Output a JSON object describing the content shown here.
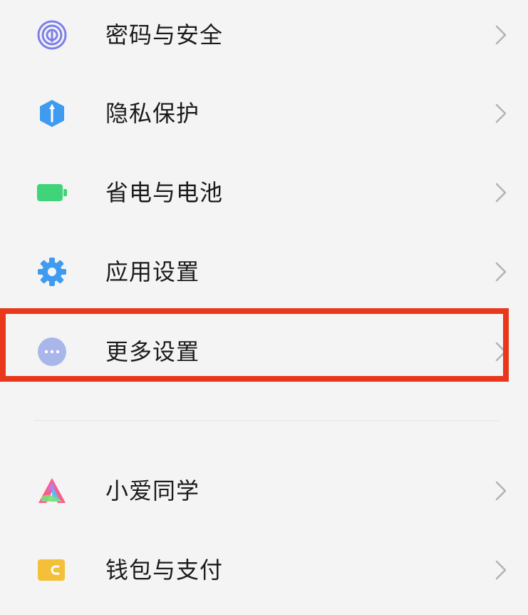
{
  "settings": {
    "items": [
      {
        "label": "密码与安全",
        "icon": "fingerprint-icon",
        "color": "#7c7fe8"
      },
      {
        "label": "隐私保护",
        "icon": "privacy-shield-icon",
        "color": "#3f9bf0"
      },
      {
        "label": "省电与电池",
        "icon": "battery-icon",
        "color": "#3fd37a"
      },
      {
        "label": "应用设置",
        "icon": "gear-icon",
        "color": "#3f9bf0"
      },
      {
        "label": "更多设置",
        "icon": "more-dots-icon",
        "color": "#a9b6ea"
      },
      {
        "label": "小爱同学",
        "icon": "xiaoai-assistant-icon",
        "color": "#ff5a8a"
      },
      {
        "label": "钱包与支付",
        "icon": "wallet-icon",
        "color": "#f4c03a"
      }
    ]
  },
  "highlight": {
    "color": "#e8371a",
    "target": "更多设置"
  }
}
